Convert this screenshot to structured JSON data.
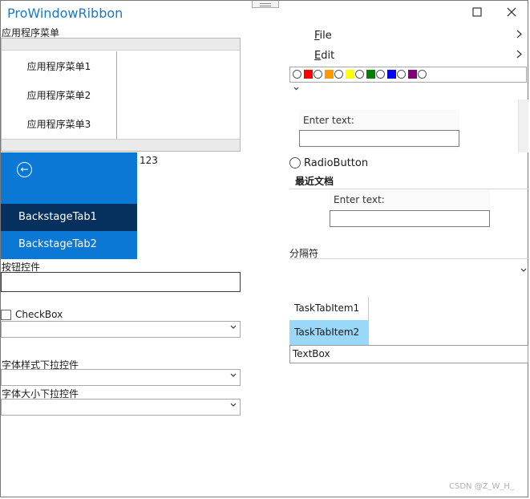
{
  "window": {
    "title": "ProWindowRibbon",
    "minimize_glyph": "",
    "maximize_glyph": "☐",
    "close_glyph": "✕"
  },
  "app_menu": {
    "label": "应用程序菜单",
    "items": [
      {
        "label": "应用程序菜单1"
      },
      {
        "label": "应用程序菜单2"
      },
      {
        "label": "应用程序菜单3"
      }
    ]
  },
  "backstage": {
    "back_glyph": "←",
    "tabs": [
      {
        "label": "BackstageTab1",
        "active": true
      },
      {
        "label": "BackstageTab2",
        "active": false
      }
    ],
    "side_number": "123"
  },
  "left_controls": {
    "button_control_label": "按钮控件",
    "checkbox_label": "CheckBox",
    "font_style_label": "字体样式下拉控件",
    "font_size_label": "字体大小下拉控件",
    "combo_chevron": "⌄"
  },
  "right_menu": {
    "items": [
      {
        "accel": "F",
        "rest": "ile",
        "arrow": "›"
      },
      {
        "accel": "E",
        "rest": "dit",
        "arrow": "›"
      }
    ],
    "gallery_colors": [
      "#ff0000",
      "#ff9900",
      "#ffff00",
      "#008000",
      "#0000ff",
      "#800080"
    ],
    "gallery_chevron": "⌄"
  },
  "text_inputs": {
    "first": {
      "label": "Enter text:",
      "value": ""
    },
    "second": {
      "label": "Enter text:",
      "value": ""
    }
  },
  "right_controls": {
    "radio_label": "RadioButton",
    "recent_docs_label": "最近文档",
    "separator_label": "分隔符",
    "separator_chevron": "⌄",
    "task_tabs": [
      {
        "label": "TaskTabItem1",
        "selected": false
      },
      {
        "label": "TaskTabItem2",
        "selected": true
      }
    ],
    "textbox_value": "TextBox"
  },
  "watermark": "CSDN @Z_W_H_"
}
